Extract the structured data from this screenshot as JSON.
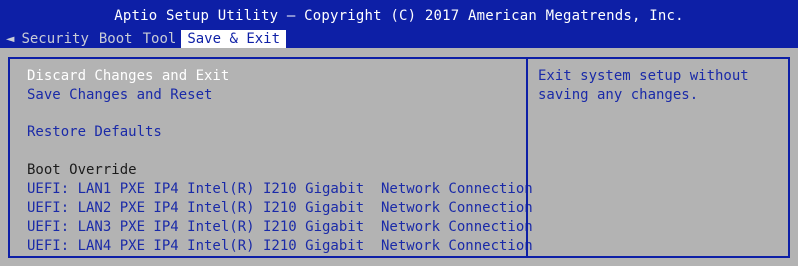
{
  "header": {
    "title": "Aptio Setup Utility – Copyright (C) 2017 American Megatrends, Inc."
  },
  "tabs": [
    {
      "label": "◄",
      "active": false
    },
    {
      "label": "Security",
      "active": false
    },
    {
      "label": "Boot",
      "active": false
    },
    {
      "label": "Tool",
      "active": false
    },
    {
      "label": "Save & Exit",
      "active": true
    }
  ],
  "menu": {
    "discard_exit": "Discard Changes and Exit",
    "save_reset": "Save Changes and Reset",
    "restore_defaults": "Restore Defaults",
    "boot_override_heading": "Boot Override",
    "boot_options": [
      "UEFI: LAN1 PXE IP4 Intel(R) I210 Gigabit  Network Connection",
      "UEFI: LAN2 PXE IP4 Intel(R) I210 Gigabit  Network Connection",
      "UEFI: LAN3 PXE IP4 Intel(R) I210 Gigabit  Network Connection",
      "UEFI: LAN4 PXE IP4 Intel(R) I210 Gigabit  Network Connection"
    ]
  },
  "help": {
    "text": "Exit system setup without saving any changes."
  },
  "colors": {
    "bios_blue": "#0d1fa6",
    "panel_gray": "#b3b3b3",
    "selected_text": "#ffffff",
    "item_text": "#1a2aa8"
  }
}
